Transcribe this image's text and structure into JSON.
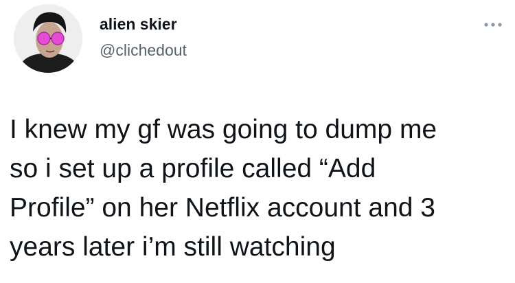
{
  "tweet": {
    "display_name": "alien skier",
    "handle": "@clichedout",
    "text": "I knew my gf was going to dump me\nso i set up a profile called “Add\nProfile” on her Netflix account and 3\nyears later i’m still watching"
  },
  "icons": {
    "avatar": "profile-photo",
    "more": "more-options-icon"
  },
  "colors": {
    "text": "#0f1419",
    "secondary": "#536471",
    "accent_glasses": "#e64bd8"
  }
}
